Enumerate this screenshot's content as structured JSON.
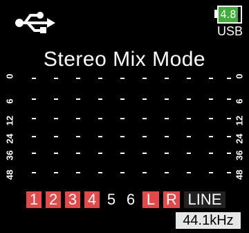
{
  "header": {
    "usb_icon": "usb-icon",
    "battery": {
      "value": "4.8",
      "color": "#3fae3a"
    },
    "power_source": "USB"
  },
  "title": "Stereo Mix Mode",
  "meter_scale": [
    "0",
    "6",
    "12",
    "24",
    "36",
    "48"
  ],
  "channels": [
    {
      "label": "1",
      "active": true
    },
    {
      "label": "2",
      "active": true
    },
    {
      "label": "3",
      "active": true
    },
    {
      "label": "4",
      "active": true
    },
    {
      "label": "5",
      "active": false
    },
    {
      "label": "6",
      "active": false
    },
    {
      "label": "L",
      "active": true
    },
    {
      "label": "R",
      "active": true
    },
    {
      "label": "LINE",
      "active": false
    }
  ],
  "sample_rate": "44.1kHz",
  "colors": {
    "active_channel": "#e24a4a",
    "battery": "#3fae3a",
    "background": "#000000"
  }
}
